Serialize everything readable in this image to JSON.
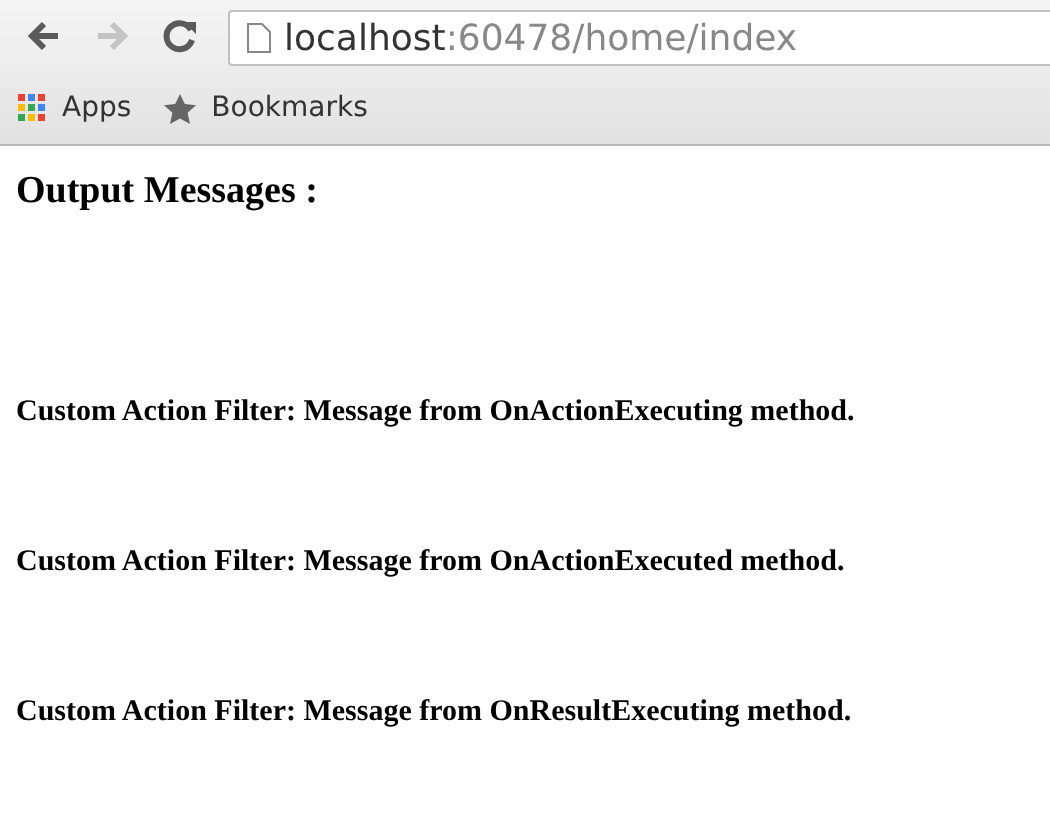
{
  "toolbar": {
    "back": {
      "disabled": false
    },
    "forward": {
      "disabled": true
    },
    "address": {
      "host": "localhost",
      "path": ":60478/home/index"
    }
  },
  "bookmarks_bar": [
    {
      "label": "Apps",
      "kind": "apps"
    },
    {
      "label": "Bookmarks",
      "kind": "star"
    }
  ],
  "content": {
    "heading": "Output Messages :",
    "messages": [
      "Custom Action Filter: Message from OnActionExecuting method.",
      "Custom Action Filter: Message from OnActionExecuted method.",
      "Custom Action Filter: Message from OnResultExecuting method."
    ]
  }
}
